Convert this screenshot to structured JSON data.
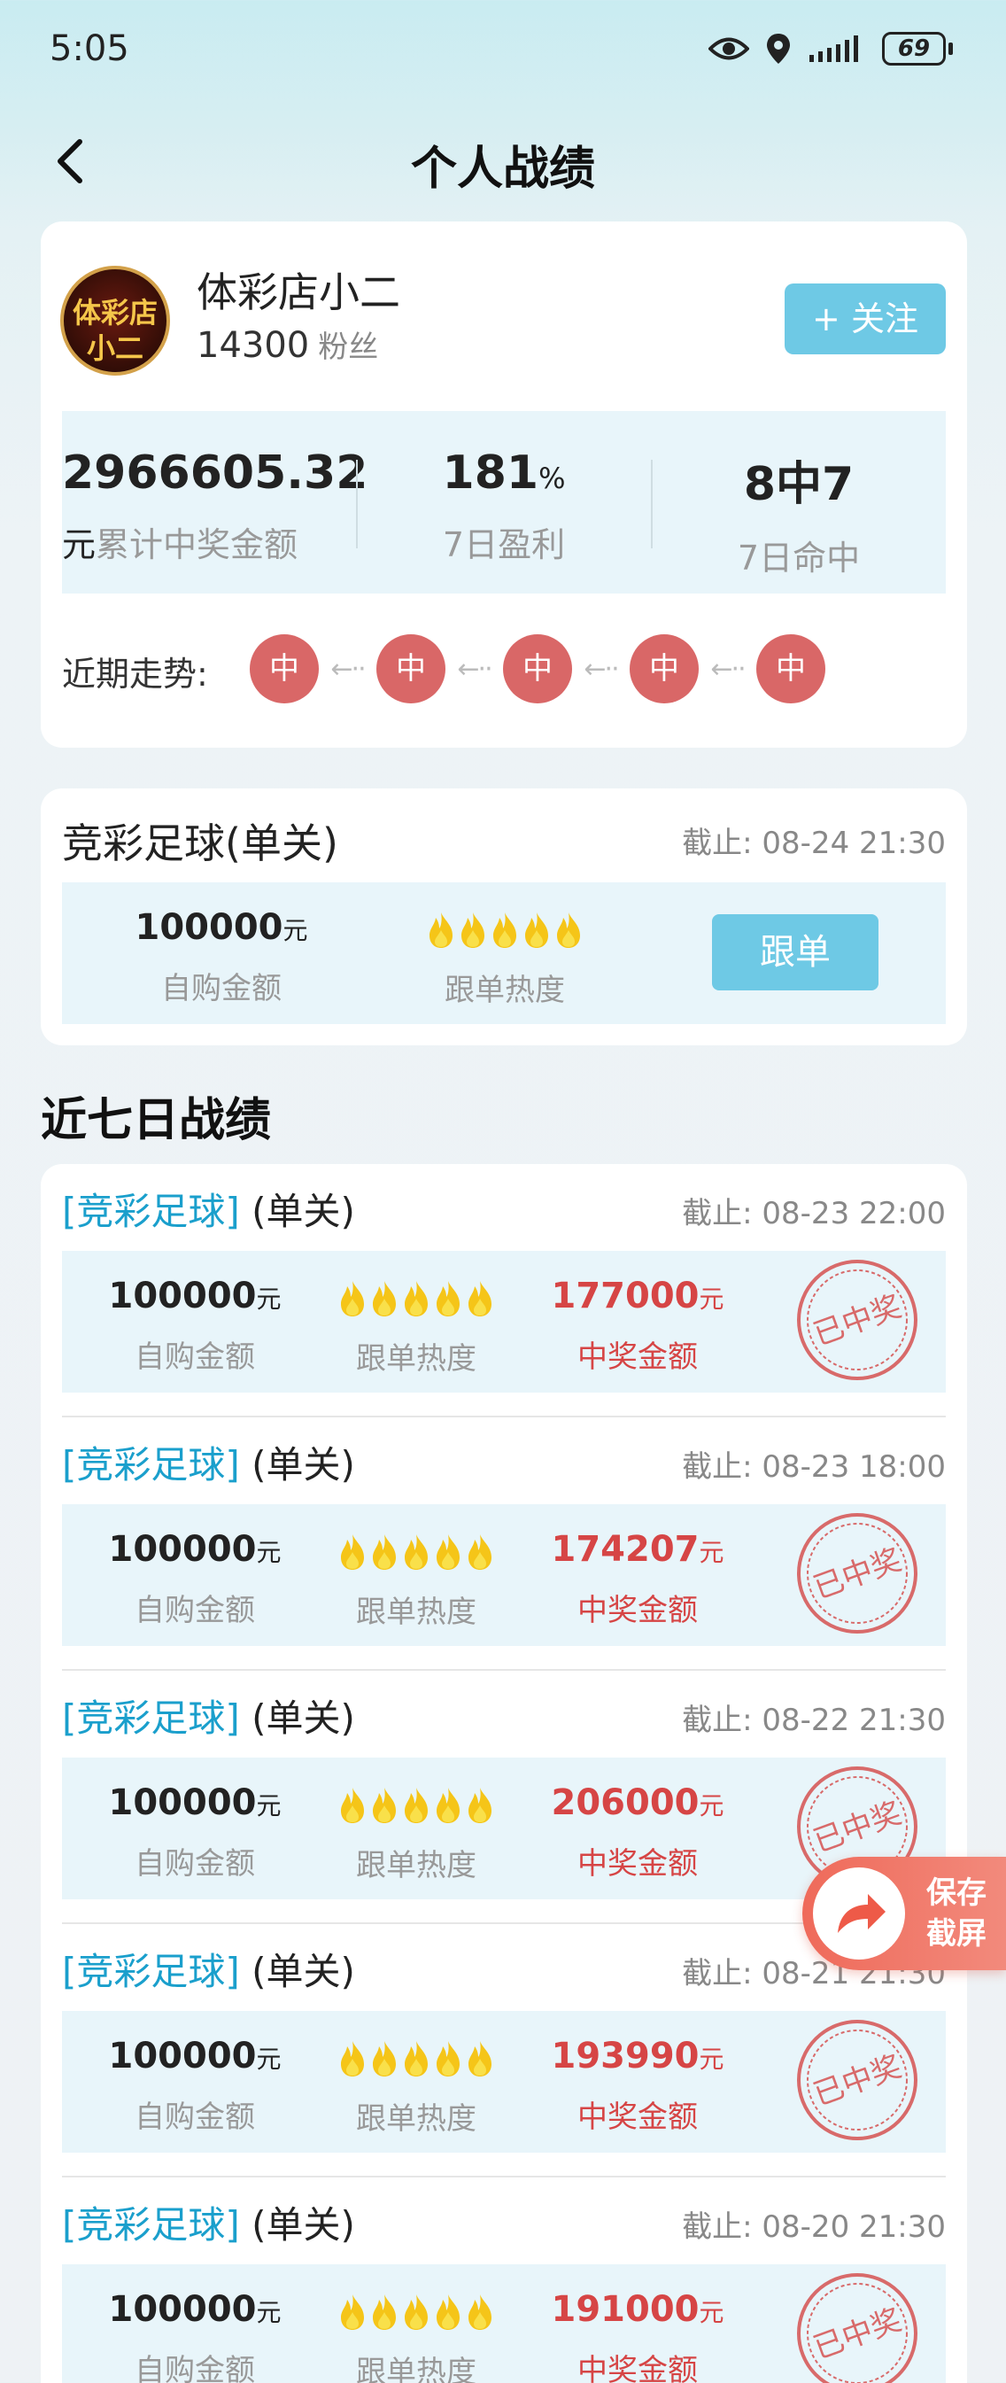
{
  "status_bar": {
    "time": "5:05",
    "battery": "69"
  },
  "nav": {
    "title": "个人战绩"
  },
  "profile": {
    "avatar_text_line1": "体彩店",
    "avatar_text_line2": "小二",
    "name": "体彩店小二",
    "fans_count": "14300",
    "fans_label": "粉丝",
    "follow_label": "+ 关注"
  },
  "stats": {
    "total_prize": "2966605.32",
    "total_prize_unit": "元",
    "total_prize_label": "累计中奖金额",
    "profit_7d": "181",
    "profit_7d_unit": "%",
    "profit_7d_label": "7日盈利",
    "hit_7d": "8中7",
    "hit_7d_label": "7日命中"
  },
  "trend": {
    "label": "近期走势:",
    "items": [
      "中",
      "中",
      "中",
      "中",
      "中"
    ],
    "arrow": "←··"
  },
  "current_plan": {
    "title": "竞彩足球(单关)",
    "deadline": "截止:  08-24 21:30",
    "amount": "100000",
    "amount_unit": "元",
    "amount_label": "自购金额",
    "heat_label": "跟单热度",
    "heat_level": 5,
    "follow_button": "跟单"
  },
  "records_section_title": "近七日战绩",
  "records": [
    {
      "tag": "[竞彩足球]",
      "type": "(单关)",
      "deadline": "截止:  08-23 22:00",
      "amount": "100000",
      "unit": "元",
      "amount_label": "自购金额",
      "heat_label": "跟单热度",
      "prize": "177000",
      "prize_label": "中奖金额",
      "stamp": "已中奖"
    },
    {
      "tag": "[竞彩足球]",
      "type": "(单关)",
      "deadline": "截止:  08-23 18:00",
      "amount": "100000",
      "unit": "元",
      "amount_label": "自购金额",
      "heat_label": "跟单热度",
      "prize": "174207",
      "prize_label": "中奖金额",
      "stamp": "已中奖"
    },
    {
      "tag": "[竞彩足球]",
      "type": "(单关)",
      "deadline": "截止:  08-22 21:30",
      "amount": "100000",
      "unit": "元",
      "amount_label": "自购金额",
      "heat_label": "跟单热度",
      "prize": "206000",
      "prize_label": "中奖金额",
      "stamp": "已中奖"
    },
    {
      "tag": "[竞彩足球]",
      "type": "(单关)",
      "deadline": "截止:  08-21 21:30",
      "amount": "100000",
      "unit": "元",
      "amount_label": "自购金额",
      "heat_label": "跟单热度",
      "prize": "193990",
      "prize_label": "中奖金额",
      "stamp": "已中奖"
    },
    {
      "tag": "[竞彩足球]",
      "type": "(单关)",
      "deadline": "截止:  08-20 21:30",
      "amount": "100000",
      "unit": "元",
      "amount_label": "自购金额",
      "heat_label": "跟单热度",
      "prize": "191000",
      "prize_label": "中奖金额",
      "stamp": "已中奖"
    }
  ],
  "save_button": {
    "line1": "保存",
    "line2": "截屏"
  },
  "colors": {
    "accent_blue": "#6ec9e5",
    "tag_blue": "#1a9fcc",
    "prize_red": "#d64545",
    "trend_red": "#d96767",
    "flame_yellow": "#f5c518"
  },
  "icons": [
    "back-arrow-icon",
    "eye-icon",
    "location-icon",
    "signal-icon",
    "battery-icon",
    "flame-icon",
    "won-stamp-icon",
    "share-arrow-icon"
  ]
}
